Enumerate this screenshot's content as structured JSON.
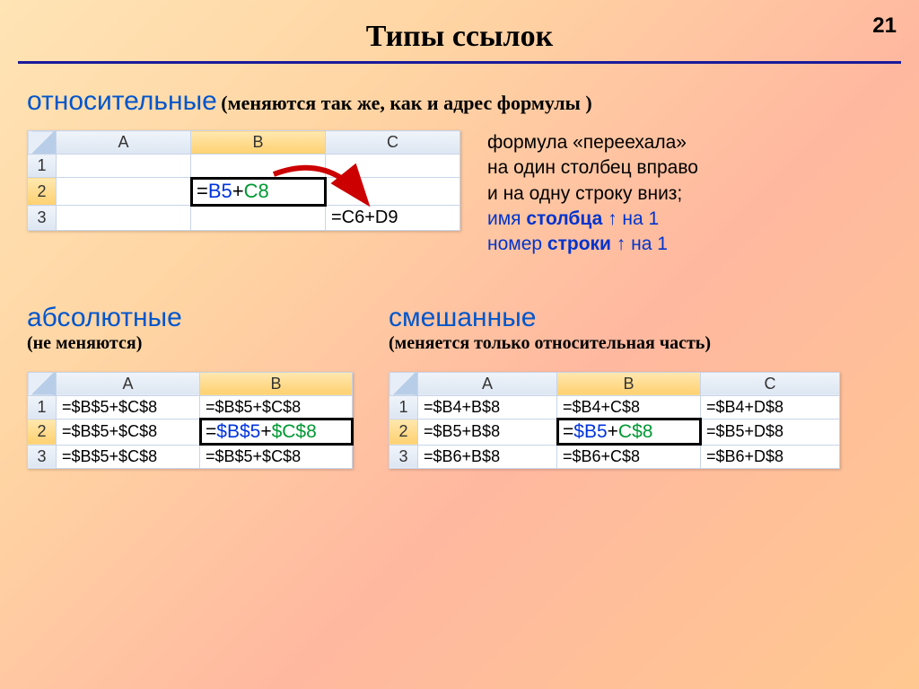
{
  "page_number": "21",
  "title": "Типы ссылок",
  "section1": {
    "heading": "относительные",
    "sub": "(меняются так же, как и адрес формулы )"
  },
  "sheet1": {
    "cols": [
      "A",
      "B",
      "C"
    ],
    "rows": [
      "1",
      "2",
      "3"
    ],
    "b2_eq": "=",
    "b2_a": "B5",
    "b2_plus": "+",
    "b2_b": "C8",
    "c3": "=C6+D9"
  },
  "explain1": {
    "l1": "формула «переехала»",
    "l2": "на один столбец вправо",
    "l3": "и на одну строку вниз;",
    "l4a": "имя ",
    "l4b": "столбца",
    "l4c": " ↑ на 1",
    "l5a": "номер ",
    "l5b": "строки",
    "l5c": " ↑ на 1"
  },
  "section2": {
    "heading": "абсолютные",
    "sub": "(не меняются)"
  },
  "section3": {
    "heading": "смешанные",
    "sub": "(меняется только относительная часть)"
  },
  "sheet2": {
    "cols": [
      "A",
      "B"
    ],
    "rows": [
      "1",
      "2",
      "3"
    ],
    "plain": "=$B$5+$C$8",
    "sel_eq": "=",
    "sel_a": "$B$5",
    "sel_plus": "+",
    "sel_b": "$C$8"
  },
  "sheet3": {
    "cols": [
      "A",
      "B",
      "C"
    ],
    "rows": [
      "1",
      "2",
      "3"
    ],
    "a1": "=$B4+B$8",
    "b1": "=$B4+C$8",
    "c1": "=$B4+D$8",
    "a2": "=$B5+B$8",
    "c2": "=$B5+D$8",
    "a3": "=$B6+B$8",
    "b3": "=$B6+C$8",
    "c3": "=$B6+D$8",
    "sel_eq": "=",
    "sel_a": "$B5",
    "sel_plus": "+",
    "sel_b": "C$8"
  }
}
